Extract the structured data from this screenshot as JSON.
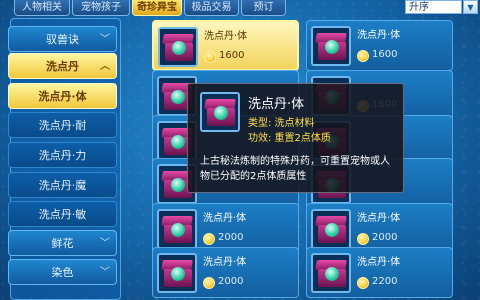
{
  "tabs": [
    {
      "label": "人物相关",
      "active": false
    },
    {
      "label": "宠物孩子",
      "active": false
    },
    {
      "label": "奇珍异宝",
      "active": true
    },
    {
      "label": "极品交易",
      "active": false
    },
    {
      "label": "预订",
      "active": false
    }
  ],
  "sort": {
    "label": "升序"
  },
  "sidebar": {
    "items": [
      {
        "label": "驭兽诀"
      },
      {
        "label": "洗点丹"
      },
      {
        "label": "洗点丹·体"
      },
      {
        "label": "洗点丹·耐"
      },
      {
        "label": "洗点丹·力"
      },
      {
        "label": "洗点丹·魔"
      },
      {
        "label": "洗点丹·敏"
      },
      {
        "label": "鲜花"
      },
      {
        "label": "染色"
      }
    ]
  },
  "grid": [
    {
      "name": "洗点丹·体",
      "price": "1600"
    },
    {
      "name": "洗点丹·体",
      "price": "1600"
    },
    {
      "name": "",
      "price": ""
    },
    {
      "name": "",
      "price": "1600"
    },
    {
      "name": "",
      "price": ""
    },
    {
      "name": "",
      "price": ""
    },
    {
      "name": "",
      "price": ""
    },
    {
      "name": "",
      "price": ""
    },
    {
      "name": "洗点丹·体",
      "price": "2000"
    },
    {
      "name": "洗点丹·体",
      "price": "2000"
    },
    {
      "name": "洗点丹·体",
      "price": "2000"
    },
    {
      "name": "洗点丹·体",
      "price": "2200"
    }
  ],
  "tooltip": {
    "title": "洗点丹·体",
    "type_line": "类型: 洗点材料",
    "effect_line": "功效: 重置2点体质",
    "description": "上古秘法炼制的特殊丹药，可重置宠物或人物已分配的2点体质属性"
  },
  "icons": {
    "chevron": "chevron-down-icon",
    "chevron_up": "chevron-up-icon",
    "coin": "coin-icon",
    "item": "gift-box-icon"
  }
}
